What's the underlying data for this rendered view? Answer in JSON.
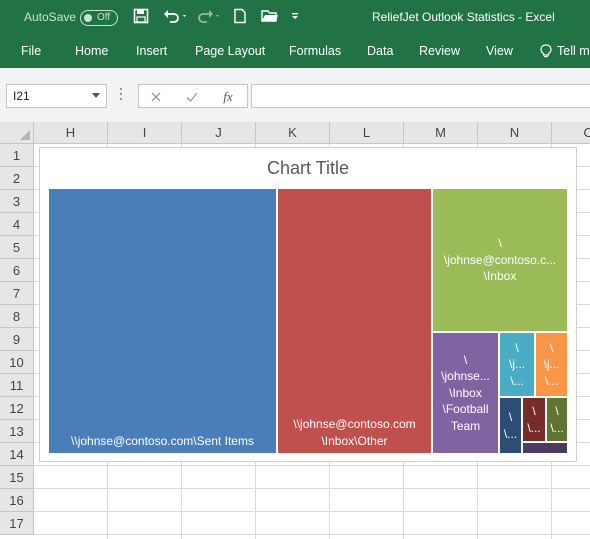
{
  "titlebar": {
    "autosave_label": "AutoSave",
    "autosave_state": "Off",
    "window_title": "ReliefJet Outlook Statistics  -  Excel"
  },
  "ribbon": {
    "tabs": [
      "File",
      "Home",
      "Insert",
      "Page Layout",
      "Formulas",
      "Data",
      "Review",
      "View",
      "Tell m"
    ]
  },
  "formula_bar": {
    "name_box": "I21",
    "fx_label": "fx",
    "value": ""
  },
  "columns": [
    "H",
    "I",
    "J",
    "K",
    "L",
    "M",
    "N",
    "O"
  ],
  "rows": [
    "1",
    "2",
    "3",
    "4",
    "5",
    "6",
    "7",
    "8",
    "9",
    "10",
    "11",
    "12",
    "13",
    "14",
    "15",
    "16",
    "17"
  ],
  "chart": {
    "title": "Chart Title"
  },
  "chart_data": {
    "type": "treemap",
    "title": "Chart Title",
    "tiles": [
      {
        "label": "\\\\johnse@contoso.com\\Sent Items",
        "lines": [
          "\\\\johnse@contoso.com\\Sent Items"
        ],
        "color": "#4a7ebb"
      },
      {
        "label": "\\\\johnse@contoso.com\\Inbox\\Other",
        "lines": [
          "\\\\johnse@contoso.com",
          "\\Inbox\\Other"
        ],
        "color": "#c0504d"
      },
      {
        "label": "\\\\johnse@contoso.c...\\Inbox",
        "lines": [
          "\\",
          "\\johnse@contoso.c...",
          "\\Inbox"
        ],
        "color": "#9bbb59"
      },
      {
        "label": "\\\\johnse...\\Inbox\\Football Team",
        "lines": [
          "\\",
          "\\johnse...",
          "\\Inbox",
          "\\Football",
          "Team"
        ],
        "color": "#8064a2"
      },
      {
        "label": "\\\\j...\\...",
        "lines": [
          "\\",
          "\\j...",
          "\\..."
        ],
        "color": "#4bacc6"
      },
      {
        "label": "\\\\j...\\...",
        "lines": [
          "\\",
          "\\j...",
          "\\..."
        ],
        "color": "#f79646"
      },
      {
        "label": "\\\\...",
        "lines": [
          "\\",
          "\\..."
        ],
        "color": "#2c4d75"
      },
      {
        "label": "\\\\...",
        "lines": [
          "\\",
          "\\..."
        ],
        "color": "#772c2a"
      },
      {
        "label": "\\\\...",
        "lines": [
          "\\",
          "\\..."
        ],
        "color": "#5f7530"
      },
      {
        "label": "",
        "lines": [],
        "color": "#4d3b62"
      }
    ]
  }
}
